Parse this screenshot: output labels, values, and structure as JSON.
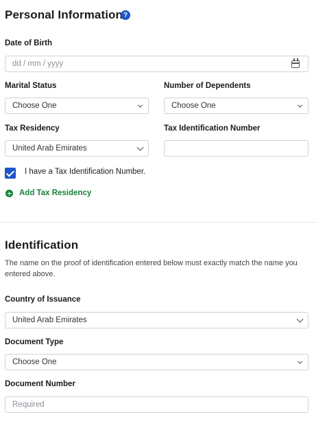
{
  "personal": {
    "title": "Personal Information",
    "help_icon": "?",
    "dob": {
      "label": "Date of Birth",
      "placeholder": "dd / mm / yyyy"
    },
    "marital": {
      "label": "Marital Status",
      "value": "Choose One"
    },
    "dependents": {
      "label": "Number of Dependents",
      "value": "Choose One"
    },
    "tax_residency": {
      "label": "Tax Residency",
      "value": "United Arab Emirates"
    },
    "tin": {
      "label": "Tax Identification Number",
      "value": ""
    },
    "has_tin": {
      "label": "I have a Tax Identification Number.",
      "checked": true
    },
    "add_tax_residency": "Add Tax Residency"
  },
  "identification": {
    "title": "Identification",
    "description": "The name on the proof of identification entered below must exactly match the name you entered above.",
    "country": {
      "label": "Country of Issuance",
      "value": "United Arab Emirates"
    },
    "doc_type": {
      "label": "Document Type",
      "value": "Choose One"
    },
    "doc_number": {
      "label": "Document Number",
      "placeholder": "Required"
    }
  },
  "colors": {
    "accent": "#1e56c8",
    "success": "#16813a",
    "border": "#cfd3d8"
  },
  "icons": [
    "help-icon",
    "calendar-icon",
    "chevron-down-icon",
    "checkmark-icon",
    "plus-circle-icon"
  ]
}
